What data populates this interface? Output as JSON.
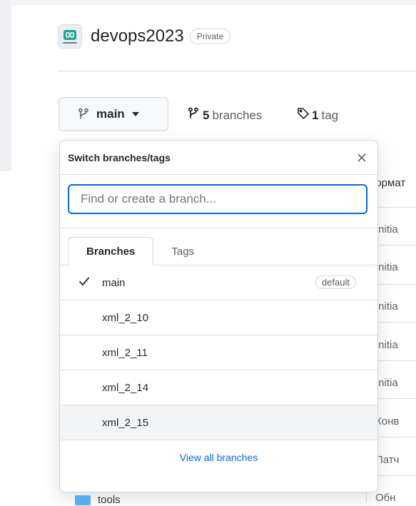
{
  "repo": {
    "name": "devops2023",
    "visibility": "Private"
  },
  "branch_bar": {
    "current_branch": "main",
    "branches_count": "5",
    "branches_label": "branches",
    "tags_count": "1",
    "tags_label": "tag"
  },
  "dropdown": {
    "title": "Switch branches/tags",
    "search_placeholder": "Find or create a branch...",
    "tabs": [
      "Branches",
      "Tags"
    ],
    "branches": [
      {
        "name": "main",
        "default_label": "default"
      },
      {
        "name": "xml_2_10"
      },
      {
        "name": "xml_2_11"
      },
      {
        "name": "xml_2_14"
      },
      {
        "name": "xml_2_15"
      }
    ],
    "view_all": "View all branches"
  },
  "background_list": {
    "rows": [
      "формат",
      "Initia",
      "Initia",
      "Initia",
      "Initia",
      "Initia",
      "Конв",
      "Патч"
    ],
    "folder_name": "tools",
    "last_row": "Обн"
  },
  "colors": {
    "accent": "#0969da",
    "folder": "#54aeff",
    "logo": "#1ea59a"
  }
}
